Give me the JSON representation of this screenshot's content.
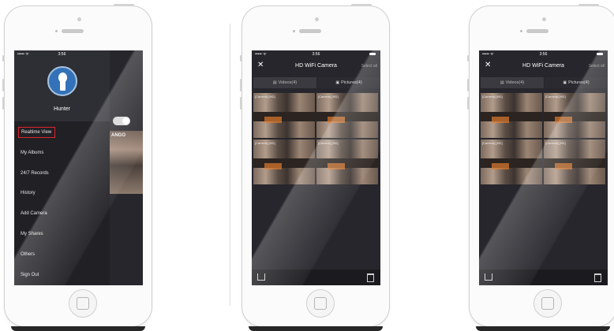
{
  "status": {
    "signal": "••••• ᯤ",
    "time": "3:56"
  },
  "drawer": {
    "user_name": "Hunter",
    "menu_items": [
      "Realtime View",
      "My Albums",
      "24/7 Records",
      "History",
      "Add Camera",
      "My Shares",
      "Others",
      "Sign Out"
    ],
    "active_item": "Realtime View",
    "peek_label": "ANGO"
  },
  "gallery": {
    "close_label": "✕",
    "title": "HD WiFi Camera",
    "select_all": "Select all",
    "tab_videos": "Videos(4)",
    "tab_pictures": "Pictures(4)",
    "thumb_label": "[Camera]  [HD]"
  },
  "colors": {
    "accent_red": "#e0242a",
    "logo_blue": "#3372b8",
    "screen_bg": "#26262c"
  }
}
